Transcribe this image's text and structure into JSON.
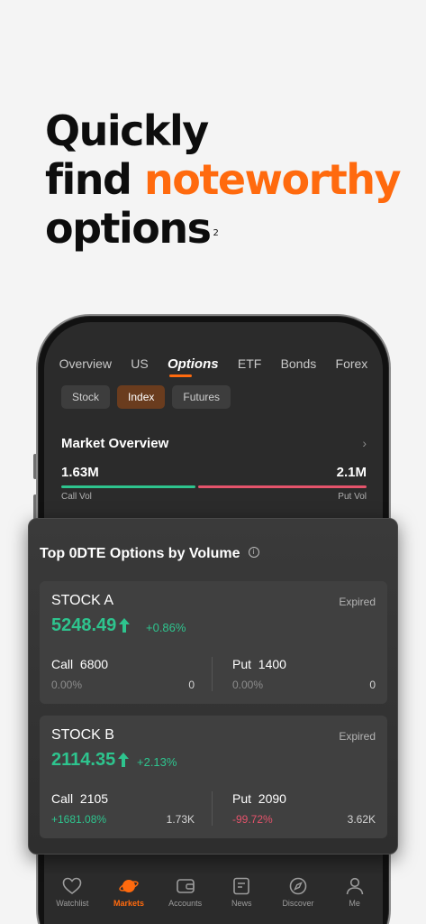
{
  "headline": {
    "line1": "Quickly",
    "line2_plain": "find",
    "line2_accent": "noteworthy",
    "line3": "options",
    "footnote": "2"
  },
  "tabs": [
    "Overview",
    "US",
    "Options",
    "ETF",
    "Bonds",
    "Forex"
  ],
  "active_tab": "Options",
  "chips": [
    "Stock",
    "Index",
    "Futures"
  ],
  "active_chip": "Index",
  "market_overview": {
    "title": "Market Overview",
    "call_vol_value": "1.63M",
    "put_vol_value": "2.1M",
    "call_vol_label": "Call Vol",
    "put_vol_label": "Put Vol",
    "call_share": 0.44
  },
  "card": {
    "title": "Top 0DTE Options by Volume",
    "items": [
      {
        "name": "STOCK A",
        "status": "Expired",
        "price": "5248.49",
        "change": "+0.86%",
        "call_label": "Call",
        "call_strike": "6800",
        "call_pct": "0.00%",
        "call_vol": "0",
        "put_label": "Put",
        "put_strike": "1400",
        "put_pct": "0.00%",
        "put_vol": "0"
      },
      {
        "name": "STOCK B",
        "status": "Expired",
        "price": "2114.35",
        "change": "+2.13%",
        "call_label": "Call",
        "call_strike": "2105",
        "call_pct": "+1681.08%",
        "call_vol": "1.73K",
        "put_label": "Put",
        "put_strike": "2090",
        "put_pct": "-99.72%",
        "put_vol": "3.62K"
      }
    ]
  },
  "bottom_nav": [
    {
      "label": "Watchlist",
      "icon": "heart-icon"
    },
    {
      "label": "Markets",
      "icon": "planet-icon"
    },
    {
      "label": "Accounts",
      "icon": "wallet-icon"
    },
    {
      "label": "News",
      "icon": "news-icon"
    },
    {
      "label": "Discover",
      "icon": "compass-icon"
    },
    {
      "label": "Me",
      "icon": "person-icon"
    }
  ],
  "active_nav": "Markets",
  "colors": {
    "accent": "#ff6a0e",
    "up": "#2ec48e",
    "down": "#e5536b"
  }
}
